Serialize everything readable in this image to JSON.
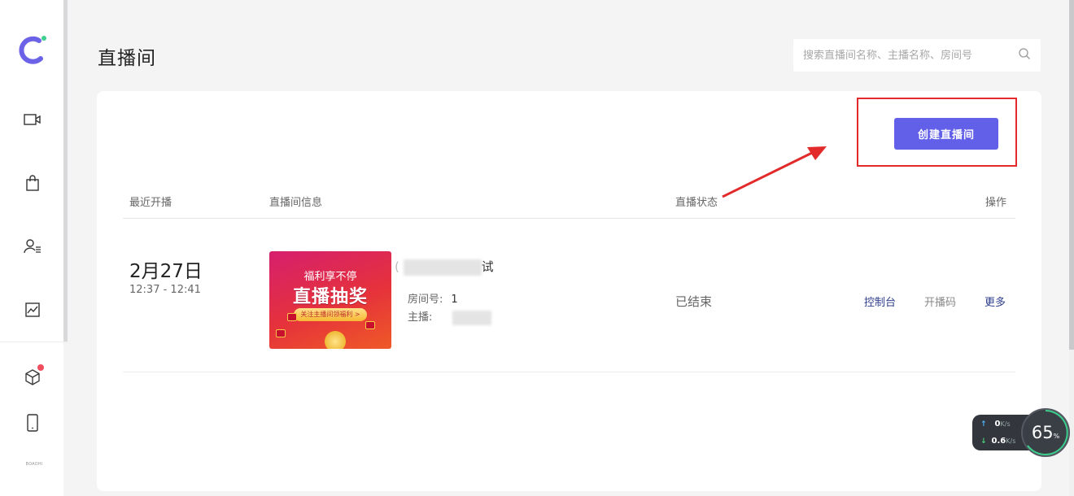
{
  "page": {
    "title": "直播间"
  },
  "search": {
    "placeholder": "搜索直播间名称、主播名称、房间号"
  },
  "actions": {
    "create_label": "创建直播间"
  },
  "table": {
    "headers": {
      "recent": "最近开播",
      "info": "直播间信息",
      "status": "直播状态",
      "ops": "操作"
    },
    "rows": [
      {
        "date": "2月27日",
        "time_range": "12:37 - 12:41",
        "thumbnail": {
          "line1": "福利享不停",
          "line2": "直播抽奖",
          "tag": "关注主播间领福利 >"
        },
        "name_suffix": "试",
        "room_no_label": "房间号:",
        "room_no": "1",
        "host_label": "主播:",
        "status": "已结束",
        "ops": {
          "console": "控制台",
          "code": "开播码",
          "more": "更多"
        }
      }
    ]
  },
  "sidebar": {
    "items": [
      "video-camera-icon",
      "shopping-bag-icon",
      "user-list-icon",
      "chart-icon"
    ],
    "bottom_items": [
      "cube-icon",
      "phone-icon"
    ],
    "brand_text": "BOAOHI"
  },
  "net_monitor": {
    "up": "0",
    "down": "0.6",
    "unit": "K/s",
    "percent": "65",
    "percent_unit": "%"
  },
  "colors": {
    "accent": "#6260e8",
    "highlight": "#e32a2a",
    "link": "#2f3e8c"
  }
}
